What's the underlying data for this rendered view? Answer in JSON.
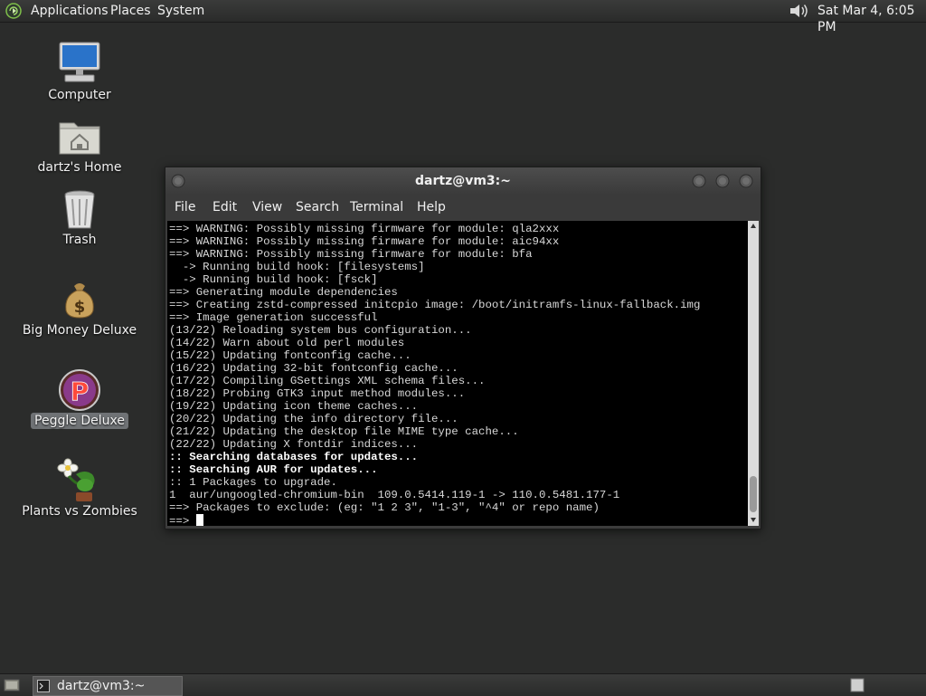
{
  "top_panel": {
    "menus": [
      "Applications",
      "Places",
      "System"
    ],
    "clock": "Sat Mar  4,  6:05 PM",
    "icons": [
      "distro-logo-icon",
      "volume-icon"
    ]
  },
  "desktop": {
    "icons": [
      {
        "label": "Computer",
        "icon": "computer-icon",
        "selected": false
      },
      {
        "label": "dartz's Home",
        "icon": "home-folder-icon",
        "selected": false
      },
      {
        "label": "Trash",
        "icon": "trash-icon",
        "selected": false
      },
      {
        "label": "Big Money Deluxe",
        "icon": "money-bag-icon",
        "selected": false
      },
      {
        "label": "Peggle Deluxe",
        "icon": "peggle-icon",
        "selected": true
      },
      {
        "label": "Plants vs Zombies",
        "icon": "flower-icon",
        "selected": false
      }
    ]
  },
  "terminal": {
    "title": "dartz@vm3:~",
    "menu": [
      "File",
      "Edit",
      "View",
      "Search",
      "Terminal",
      "Help"
    ],
    "lines": [
      {
        "text": "==> WARNING: Possibly missing firmware for module: qla2xxx",
        "bold": false
      },
      {
        "text": "==> WARNING: Possibly missing firmware for module: aic94xx",
        "bold": false
      },
      {
        "text": "==> WARNING: Possibly missing firmware for module: bfa",
        "bold": false
      },
      {
        "text": "  -> Running build hook: [filesystems]",
        "bold": false
      },
      {
        "text": "  -> Running build hook: [fsck]",
        "bold": false
      },
      {
        "text": "==> Generating module dependencies",
        "bold": false
      },
      {
        "text": "==> Creating zstd-compressed initcpio image: /boot/initramfs-linux-fallback.img",
        "bold": false
      },
      {
        "text": "==> Image generation successful",
        "bold": false
      },
      {
        "text": "(13/22) Reloading system bus configuration...",
        "bold": false
      },
      {
        "text": "(14/22) Warn about old perl modules",
        "bold": false
      },
      {
        "text": "(15/22) Updating fontconfig cache...",
        "bold": false
      },
      {
        "text": "(16/22) Updating 32-bit fontconfig cache...",
        "bold": false
      },
      {
        "text": "(17/22) Compiling GSettings XML schema files...",
        "bold": false
      },
      {
        "text": "(18/22) Probing GTK3 input method modules...",
        "bold": false
      },
      {
        "text": "(19/22) Updating icon theme caches...",
        "bold": false
      },
      {
        "text": "(20/22) Updating the info directory file...",
        "bold": false
      },
      {
        "text": "(21/22) Updating the desktop file MIME type cache...",
        "bold": false
      },
      {
        "text": "(22/22) Updating X fontdir indices...",
        "bold": false
      },
      {
        "text": ":: Searching databases for updates...",
        "bold": true
      },
      {
        "text": ":: Searching AUR for updates...",
        "bold": true
      },
      {
        "text": ":: 1 Packages to upgrade.",
        "bold": false
      },
      {
        "text": "1  aur/ungoogled-chromium-bin  109.0.5414.119-1 -> 110.0.5481.177-1",
        "bold": false
      },
      {
        "text": "==> Packages to exclude: (eg: \"1 2 3\", \"1-3\", \"^4\" or repo name)",
        "bold": false
      }
    ],
    "prompt": "==> "
  },
  "bottom_panel": {
    "tasks": [
      {
        "label": "dartz@vm3:~",
        "icon": "terminal-icon"
      }
    ],
    "icons": [
      "show-desktop-icon",
      "workspace-switcher-icon"
    ]
  }
}
